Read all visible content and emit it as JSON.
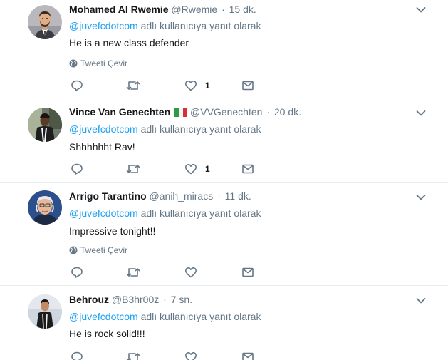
{
  "tweets": [
    {
      "display_name": "Mohamed Al Rwemie",
      "handle": "@Rwemie",
      "separator": "·",
      "time": "15 dk.",
      "reply_mention": "@juvefcdotcom",
      "reply_suffix": " adlı kullanıcıya yanıt olarak",
      "text": "He is a new class defender",
      "translate": "Tweeti Çevir",
      "like_count": "1"
    },
    {
      "display_name": "Vince Van Genechten",
      "handle": "@VVGenechten",
      "separator": "·",
      "time": "20 dk.",
      "reply_mention": "@juvefcdotcom",
      "reply_suffix": " adlı kullanıcıya yanıt olarak",
      "text": "Shhhhhht Rav!",
      "like_count": "1"
    },
    {
      "display_name": "Arrigo Tarantino",
      "handle": "@anih_miracs",
      "separator": "·",
      "time": "11 dk.",
      "reply_mention": "@juvefcdotcom",
      "reply_suffix": " adlı kullanıcıya yanıt olarak",
      "text": "Impressive tonight!!",
      "translate": "Tweeti Çevir"
    },
    {
      "display_name": "Behrouz",
      "handle": "@B3hr00z",
      "separator": "·",
      "time": "7 sn.",
      "reply_mention": "@juvefcdotcom",
      "reply_suffix": " adlı kullanıcıya yanıt olarak",
      "text": "He is rock solid!!!"
    }
  ],
  "colors": {
    "link": "#1da1f2",
    "secondary_text": "#657786",
    "primary_text": "#14171a",
    "divider": "#e6ecf0"
  },
  "icons": [
    "reply-icon",
    "retweet-icon",
    "like-icon",
    "direct-message-icon",
    "caret-down-icon",
    "globe-icon",
    "italy-flag-icon"
  ]
}
